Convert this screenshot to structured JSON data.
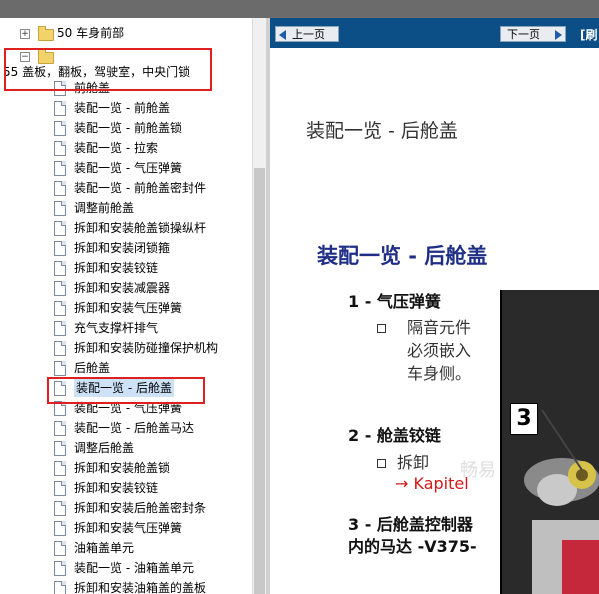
{
  "tree": {
    "items": [
      {
        "label": "50 车身前部",
        "type": "folder"
      },
      {
        "label": "55 盖板，翻板，驾驶室，中央门锁",
        "type": "folder"
      },
      {
        "label": "前舱盖",
        "type": "doc"
      },
      {
        "label": "装配一览 - 前舱盖",
        "type": "doc"
      },
      {
        "label": "装配一览 - 前舱盖锁",
        "type": "doc"
      },
      {
        "label": "装配一览 - 拉索",
        "type": "doc"
      },
      {
        "label": "装配一览 - 气压弹簧",
        "type": "doc"
      },
      {
        "label": "装配一览 - 前舱盖密封件",
        "type": "doc"
      },
      {
        "label": "调整前舱盖",
        "type": "doc"
      },
      {
        "label": "拆卸和安装舱盖锁操纵杆",
        "type": "doc"
      },
      {
        "label": "拆卸和安装闭锁箍",
        "type": "doc"
      },
      {
        "label": "拆卸和安装铰链",
        "type": "doc"
      },
      {
        "label": "拆卸和安装减震器",
        "type": "doc"
      },
      {
        "label": "拆卸和安装气压弹簧",
        "type": "doc"
      },
      {
        "label": "充气支撑杆排气",
        "type": "doc"
      },
      {
        "label": "拆卸和安装防碰撞保护机构",
        "type": "doc"
      },
      {
        "label": "后舱盖",
        "type": "doc"
      },
      {
        "label": "装配一览 - 后舱盖",
        "type": "doc",
        "selected": true
      },
      {
        "label": "装配一览 - 气压弹簧",
        "type": "doc"
      },
      {
        "label": "装配一览 - 后舱盖马达",
        "type": "doc"
      },
      {
        "label": "调整后舱盖",
        "type": "doc"
      },
      {
        "label": "拆卸和安装舱盖锁",
        "type": "doc"
      },
      {
        "label": "拆卸和安装铰链",
        "type": "doc"
      },
      {
        "label": "拆卸和安装后舱盖密封条",
        "type": "doc"
      },
      {
        "label": "拆卸和安装气压弹簧",
        "type": "doc"
      },
      {
        "label": "油箱盖单元",
        "type": "doc"
      },
      {
        "label": "装配一览 - 油箱盖单元",
        "type": "doc"
      },
      {
        "label": "拆卸和安装油箱盖的盖板",
        "type": "doc"
      }
    ]
  },
  "nav": {
    "prev": "上一页",
    "next": "下一页",
    "extra": "[刷"
  },
  "doc": {
    "title_small": "装配一览 - 后舱盖",
    "title_big": "装配一览 - 后舱盖",
    "item1": "1 - 气压弹簧",
    "item1_body": "隔音元件必须嵌入车身侧。",
    "item2": "2 - 舱盖铰链",
    "item2_body": "拆卸",
    "item2_link": "→ Kapitel",
    "item3": "3 - 后舱盖控制器内的马达 -V375-",
    "photo_label": "3",
    "watermark": "畅易"
  }
}
